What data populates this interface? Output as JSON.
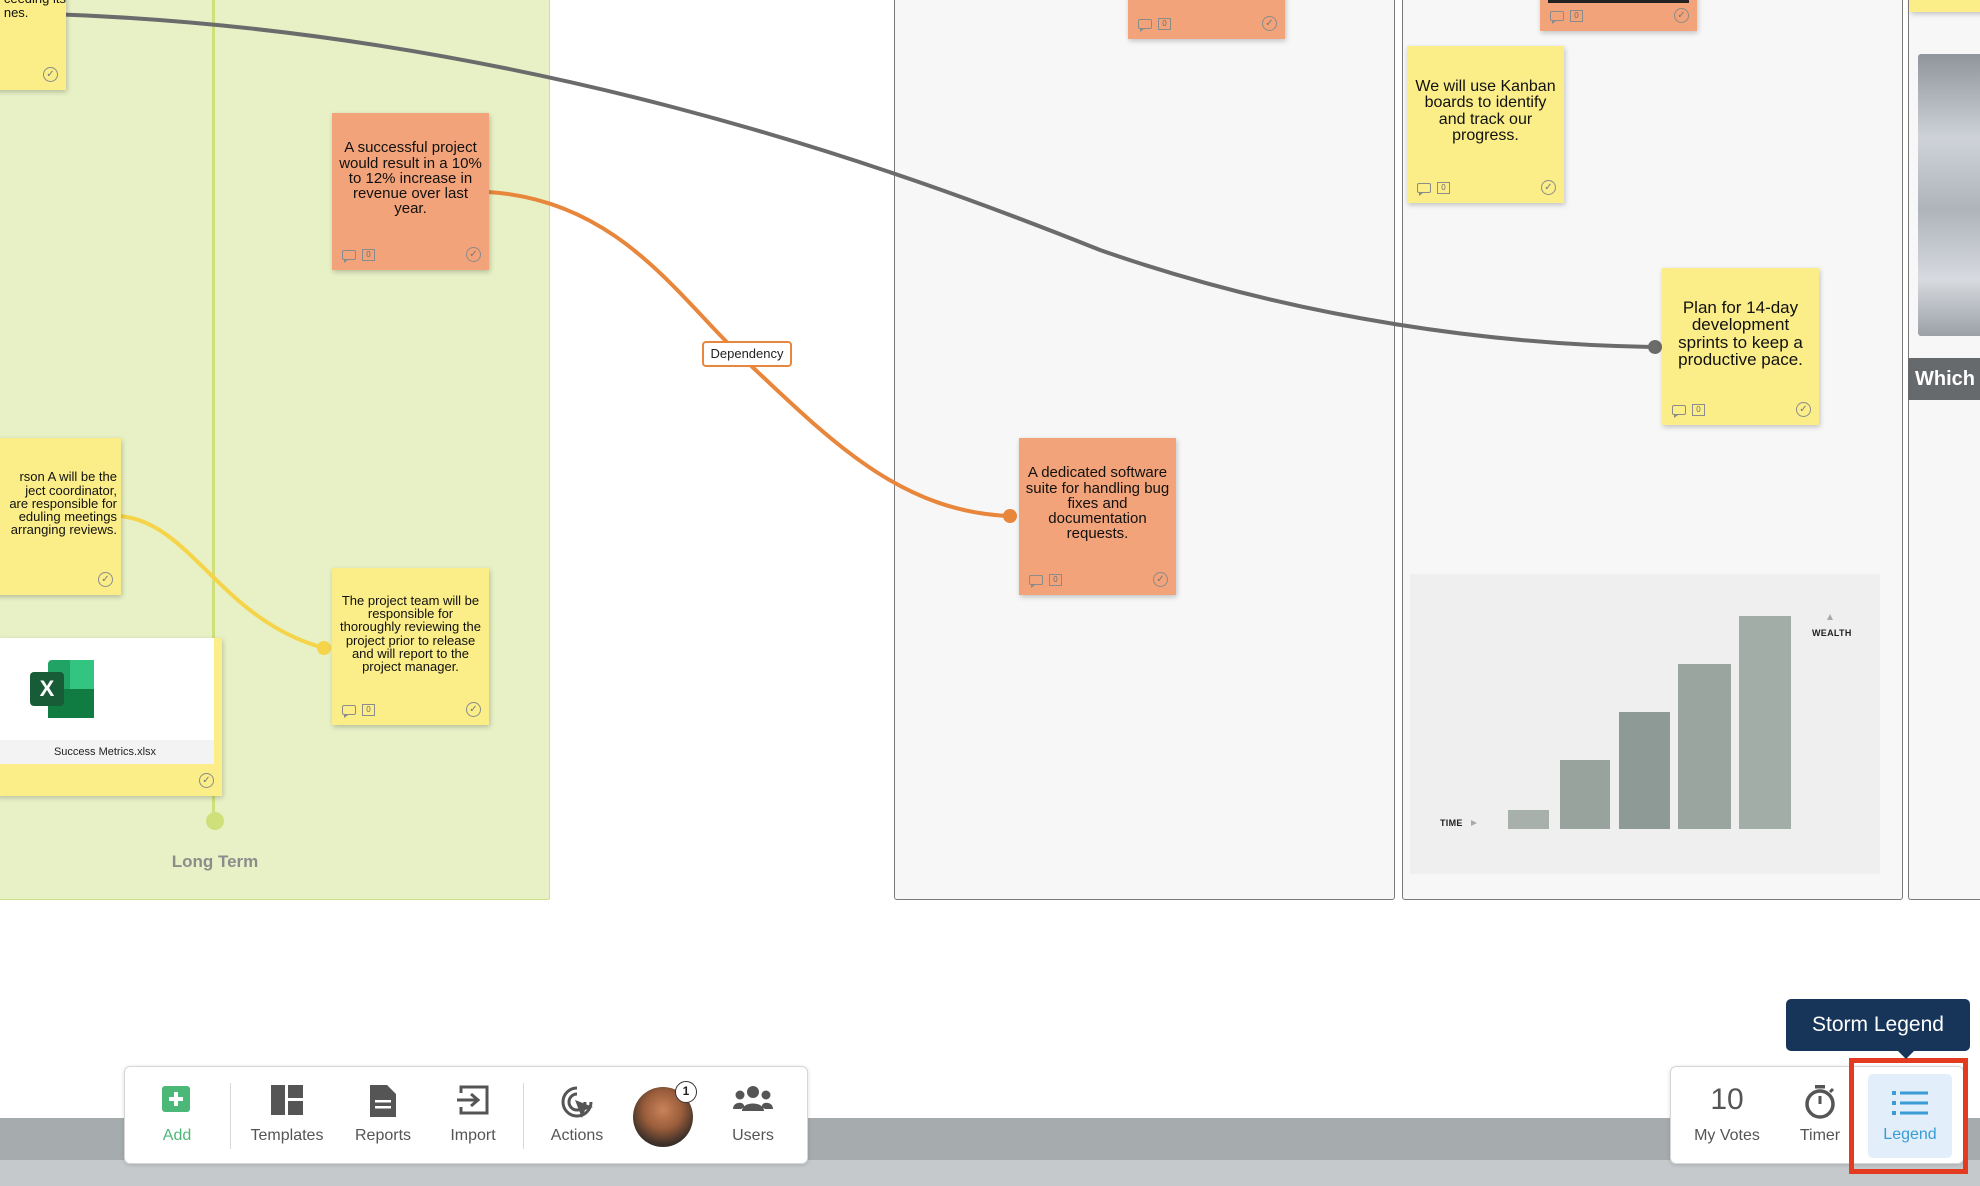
{
  "board": {
    "lane_label": "Long Term",
    "dependency_label": "Dependency",
    "notes": [
      {
        "text": "nsistently\nceeding its\nnes."
      },
      {
        "text": "A successful project would result in a 10% to 12% increase in revenue over last year."
      },
      {
        "text": "rson A will be the\nject coordinator,\nare responsible for\neduling meetings\narranging reviews."
      },
      {
        "text": "The project team will be responsible for thoroughly reviewing the project prior to release and will report to the project manager."
      },
      {
        "text": "A dedicated software suite for handling bug fixes and documentation requests."
      },
      {
        "text": "We will use Kanban boards to identify and track our progress."
      },
      {
        "text": "Plan for 14-day development sprints to keep a productive pace."
      }
    ],
    "note_comment_count": "0",
    "file": {
      "name": "Success Metrics.xlsx",
      "app_icon": "excel-icon",
      "app_letter": "X"
    },
    "chart_image": {
      "time_label": "TIME",
      "wealth_label": "WEALTH"
    },
    "partial_column_title": "Which"
  },
  "toolbar": {
    "add": "Add",
    "templates": "Templates",
    "reports": "Reports",
    "import": "Import",
    "actions": "Actions",
    "users": "Users",
    "user_badge": "1",
    "my_votes_count": "10",
    "my_votes": "My Votes",
    "timer": "Timer",
    "legend": "Legend"
  },
  "tooltip": {
    "text": "Storm Legend"
  },
  "colors": {
    "sticky_yellow": "#fbee88",
    "sticky_orange": "#f3a379",
    "lane_green": "#e8f1c6",
    "dependency_line": "#e8863b",
    "link_line": "#6b6b6b",
    "yellow_line": "#f5d44a",
    "add_green": "#4cb877",
    "legend_blue": "#3a9bd5",
    "highlight_red": "#e43a1f",
    "tooltip_navy": "#173559"
  }
}
